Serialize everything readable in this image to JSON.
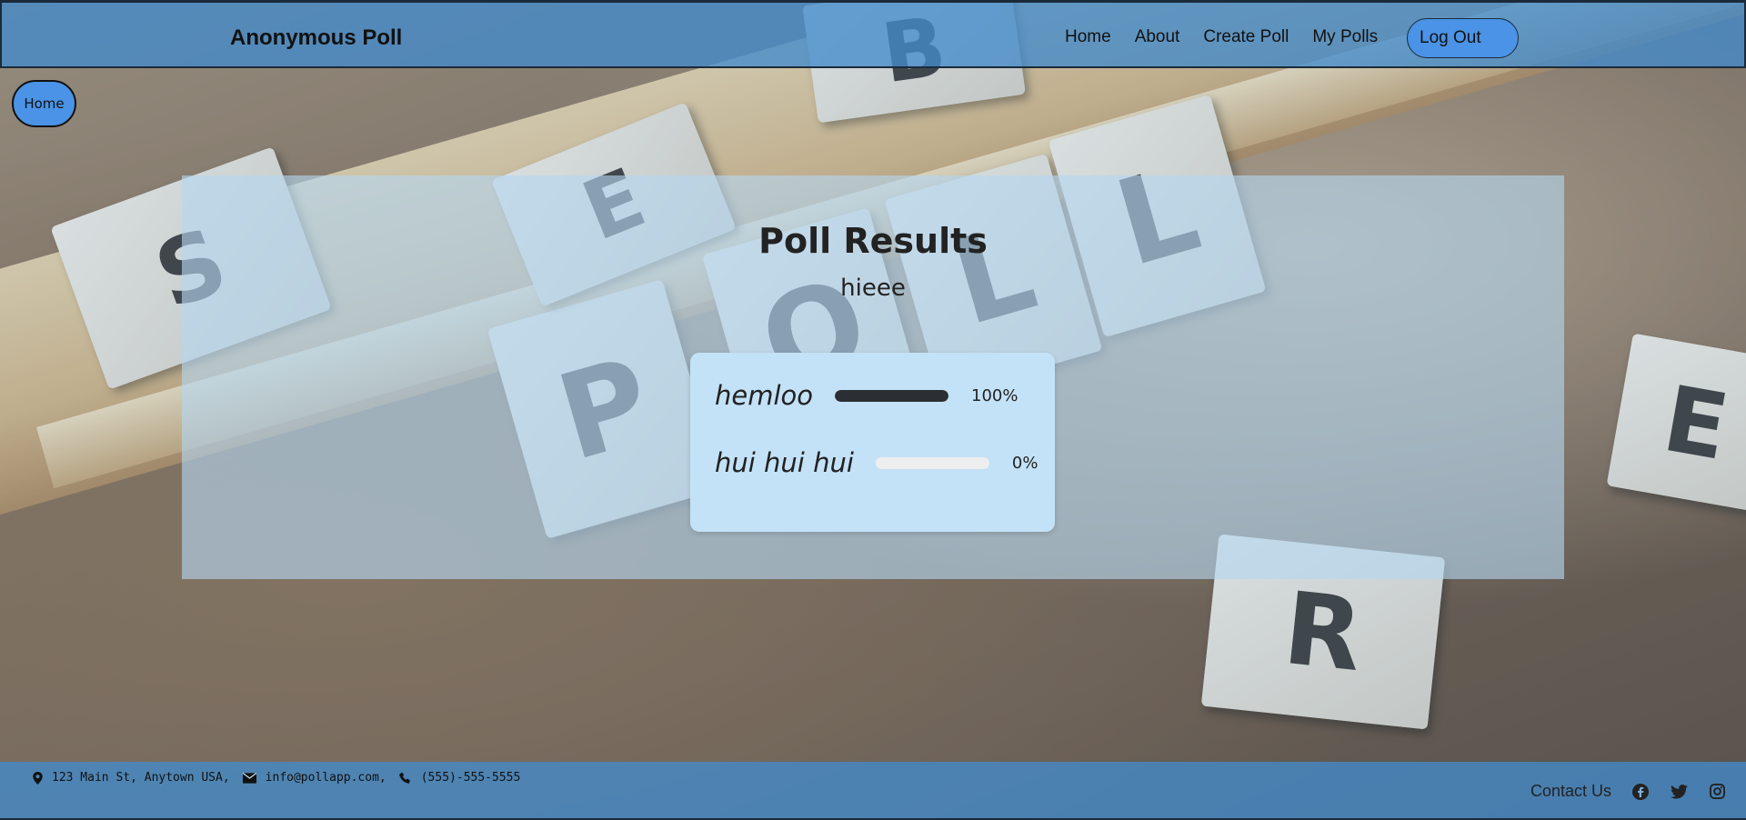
{
  "navbar": {
    "brand": "Anonymous Poll",
    "links": [
      "Home",
      "About",
      "Create Poll",
      "My Polls"
    ],
    "logout_label": "Log Out"
  },
  "home_button": "Home",
  "results": {
    "title": "Poll Results",
    "question": "hieee",
    "options": [
      {
        "name": "hemloo",
        "percent_label": "100%",
        "fraction": 1.0
      },
      {
        "name": "hui hui hui",
        "percent_label": "0%",
        "fraction": 0.0
      }
    ]
  },
  "footer": {
    "address": "123 Main St, Anytown USA,",
    "email": "info@pollapp.com,",
    "phone": "(555)-555-5555",
    "contact_label": "Contact Us",
    "social_icons": [
      "facebook-icon",
      "twitter-icon",
      "instagram-icon"
    ]
  },
  "colors": {
    "nav_bg": "#428bca",
    "button_bg": "#4a93e6",
    "panel_bg": "#b4d7f0",
    "card_bg": "#c3e2f7",
    "bar_fill": "#2b2f33",
    "bar_track": "#eeeeee"
  }
}
